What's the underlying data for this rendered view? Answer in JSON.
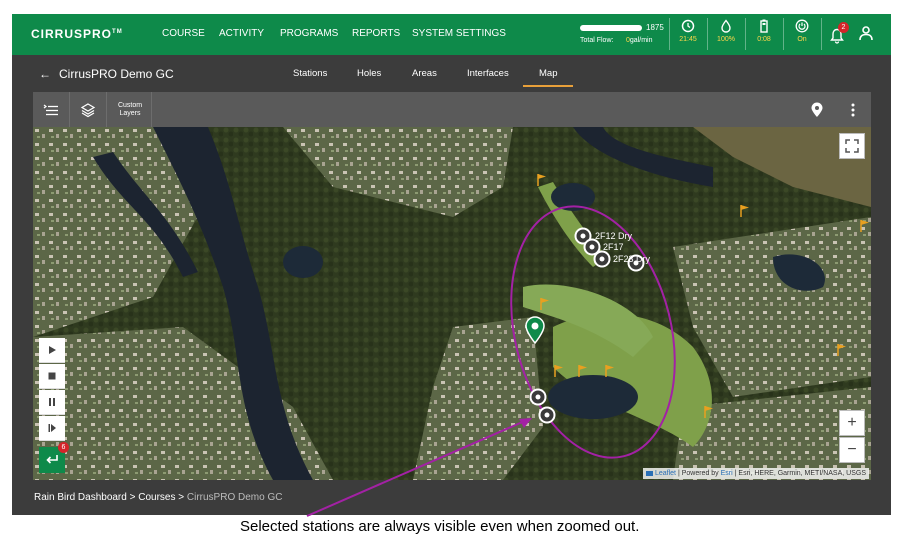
{
  "app": {
    "logo_main": "CIRRUS",
    "logo_pro": "PRO",
    "logo_tm": "TM",
    "nav": [
      "COURSE",
      "ACTIVITY",
      "PROGRAMS",
      "REPORTS",
      "SYSTEM SETTINGS"
    ],
    "flow": {
      "value": "1875",
      "label": "Total Flow:",
      "rate_value": "0",
      "rate_unit": "gal/min"
    },
    "stats": [
      {
        "icon": "clock-icon",
        "value": "21:45"
      },
      {
        "icon": "water-drop-icon",
        "value": "100%"
      },
      {
        "icon": "battery-icon",
        "value": "0:08"
      },
      {
        "icon": "power-icon",
        "value": "On"
      }
    ],
    "notifications_count": "2",
    "accent_color": "#0e8a4a",
    "highlight_color": "#ffd84a"
  },
  "subheader": {
    "back_glyph": "←",
    "title": "CirrusPRO Demo GC",
    "tabs": [
      "Stations",
      "Holes",
      "Areas",
      "Interfaces",
      "Map"
    ],
    "active_tab": "Map"
  },
  "toolbar": {
    "custom_layers_label": "Custom Layers",
    "icons": [
      "filter-list-icon",
      "layers-icon",
      "location-pin-icon",
      "more-vertical-icon"
    ]
  },
  "map": {
    "stations": [
      "2F12 Dry",
      "2F17",
      "2F23 Dry"
    ],
    "zoom_in": "+",
    "zoom_out": "−",
    "return_badge": "6",
    "attribution": {
      "leaflet": "Leaflet",
      "powered_by": "| Powered by",
      "esri": "Esri",
      "sources": "| Esri, HERE, Garmin, METI/NASA, USGS"
    }
  },
  "breadcrumb": {
    "items": [
      "Rain Bird Dashboard",
      "Courses",
      "CirrusPRO Demo GC"
    ],
    "separator": ">"
  },
  "caption": "Selected stations are always visible even when zoomed out."
}
